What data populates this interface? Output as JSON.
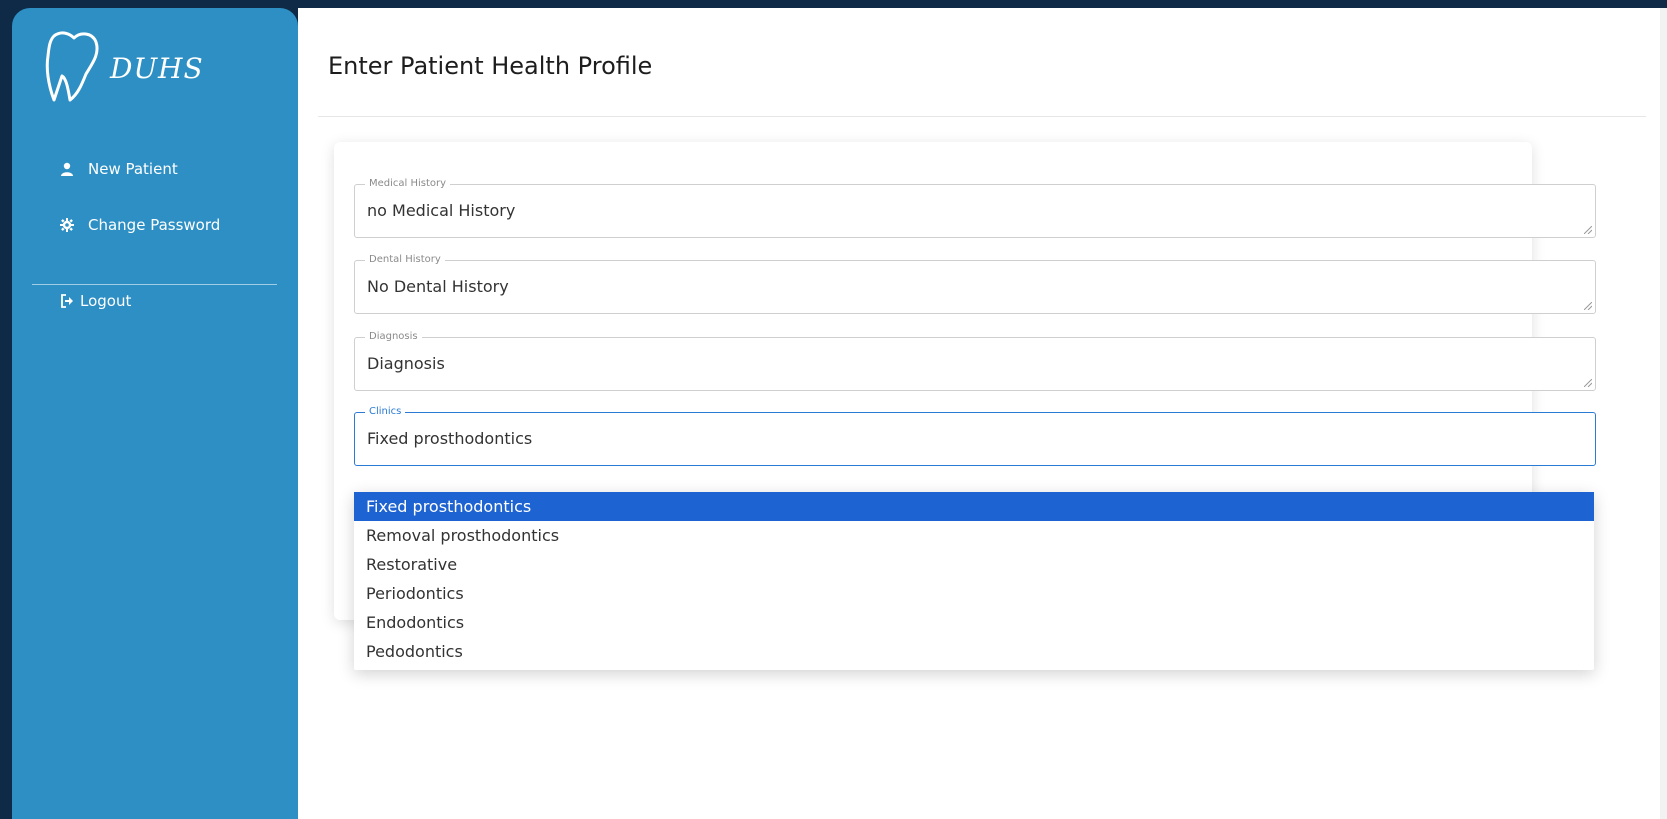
{
  "brand": {
    "logo_text": "DUHS"
  },
  "sidebar": {
    "items": [
      {
        "label": "New Patient",
        "icon": "user-icon"
      },
      {
        "label": "Change Password",
        "icon": "gear-icon"
      },
      {
        "label": "Logout",
        "icon": "logout-icon"
      }
    ]
  },
  "page": {
    "title": "Enter Patient Health Profile"
  },
  "form": {
    "medical_history": {
      "label": "Medical History",
      "value": "no Medical History"
    },
    "dental_history": {
      "label": "Dental History",
      "value": "No Dental History"
    },
    "diagnosis": {
      "label": "Diagnosis",
      "value": "Diagnosis"
    },
    "clinics": {
      "label": "Clinics",
      "value": "Fixed prosthodontics",
      "options": [
        "Fixed prosthodontics",
        "Removal prosthodontics",
        "Restorative",
        "Periodontics",
        "Endodontics",
        "Pedodontics"
      ]
    }
  },
  "colors": {
    "sidebar": "#2d8fc3",
    "background": "#0f2a47",
    "selected_option": "#1e63d2"
  }
}
